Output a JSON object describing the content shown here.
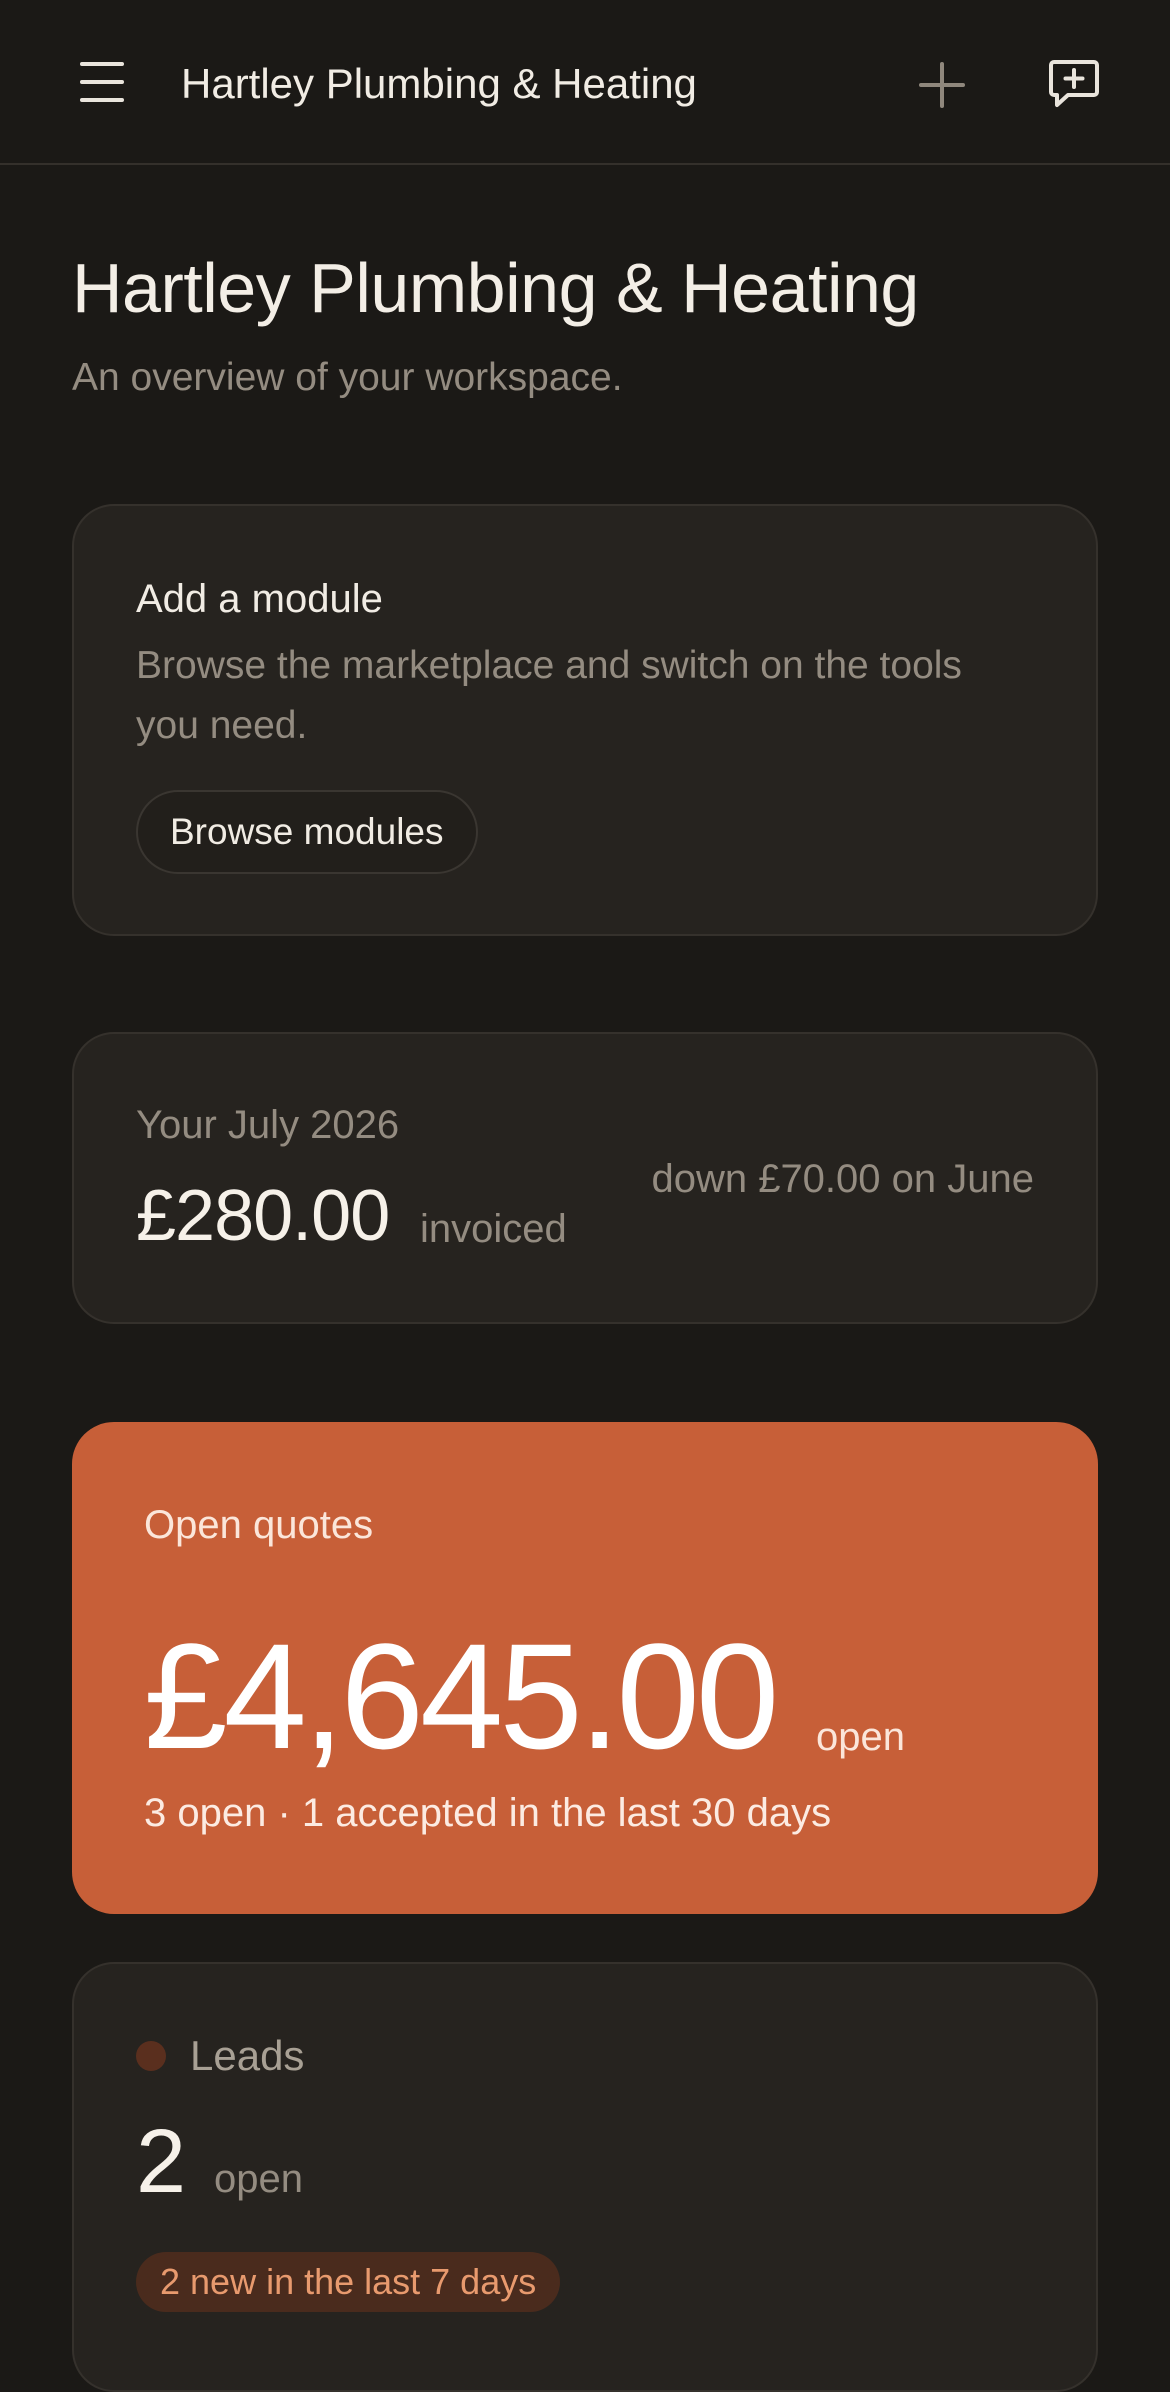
{
  "header": {
    "title": "Hartley Plumbing & Heating",
    "menu_icon": "hamburger-menu-icon",
    "add_icon": "plus-icon",
    "chat_icon": "chat-add-icon"
  },
  "page": {
    "title": "Hartley Plumbing & Heating",
    "subtitle": "An overview of your workspace."
  },
  "module_card": {
    "title": "Add a module",
    "description": "Browse the marketplace and switch on the tools you need.",
    "button_label": "Browse modules"
  },
  "invoice_card": {
    "period_label": "Your July 2026",
    "amount": "£280.00",
    "amount_suffix": "invoiced",
    "comparison": "down £70.00 on June"
  },
  "quotes_card": {
    "label": "Open quotes",
    "amount": "£4,645.00",
    "amount_suffix": "open",
    "stats": "3 open · 1 accepted in the last 30 days",
    "accent_color": "#c75f38"
  },
  "leads_card": {
    "label": "Leads",
    "count": "2",
    "count_suffix": "open",
    "badge": "2 new in the last 7 days"
  }
}
